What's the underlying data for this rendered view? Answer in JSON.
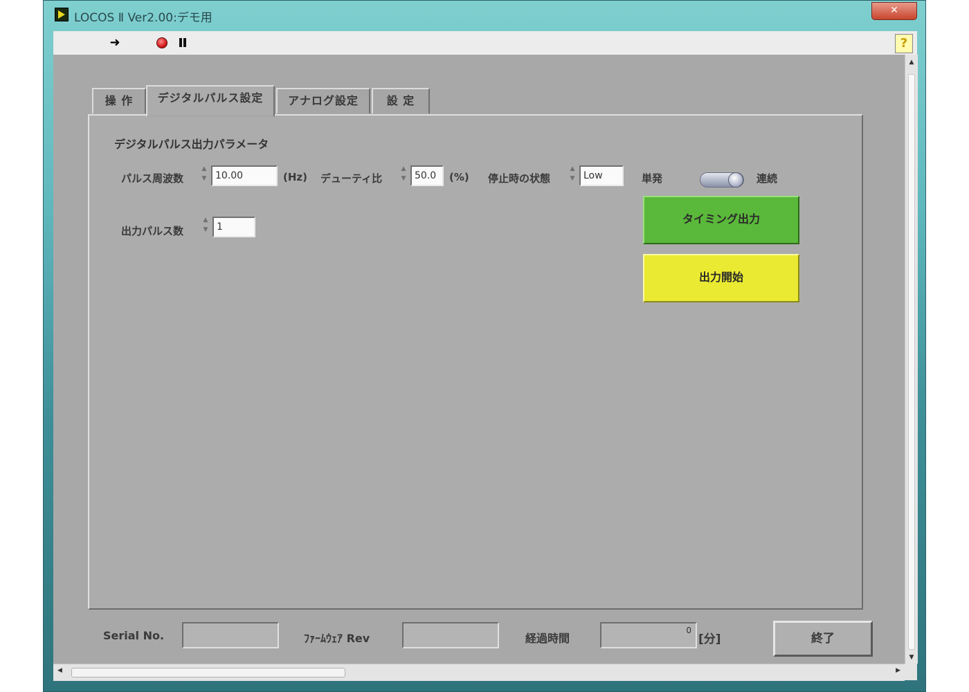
{
  "window": {
    "title": "LOCOS Ⅱ Ver2.00:デモ用",
    "close_label": "✕"
  },
  "toolbar": {
    "run_icon": "run-arrow-icon",
    "abort_icon": "abort-icon",
    "pause_icon": "pause-icon",
    "help_label": "?"
  },
  "tabs": [
    {
      "label": "操 作",
      "active": false
    },
    {
      "label": "デジタルパルス設定",
      "active": true
    },
    {
      "label": "アナログ設定",
      "active": false
    },
    {
      "label": "設 定",
      "active": false
    }
  ],
  "digital": {
    "section_title": "デジタルパルス出力パラメータ",
    "freq_label": "パルス周波数",
    "freq_value": "10.00",
    "freq_unit": "(Hz)",
    "duty_label": "デューティ比",
    "duty_value": "50.0",
    "duty_unit": "(%)",
    "stop_state_label": "停止時の状態",
    "stop_state_value": "Low",
    "mode_single": "単発",
    "mode_continuous": "連続",
    "pulse_count_label": "出力パルス数",
    "pulse_count_value": "1",
    "timing_button": "タイミング出力",
    "start_button": "出力開始"
  },
  "status": {
    "serial_label": "Serial No.",
    "serial_value": "",
    "firmware_label": "ﾌｧｰﾑｳｪｱ Rev",
    "firmware_value": "",
    "elapsed_label": "経過時間",
    "elapsed_value": "0",
    "elapsed_unit": "[分]",
    "end_button": "終了"
  },
  "colors": {
    "panel": "#a8a8a8",
    "timing_button": "#5ab83a",
    "start_button": "#eaea32"
  }
}
